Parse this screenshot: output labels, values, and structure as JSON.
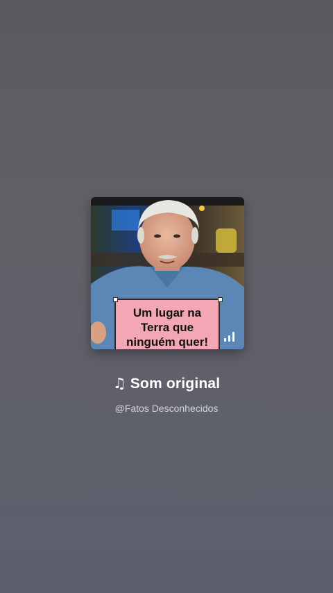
{
  "sound": {
    "cover_caption": [
      "Um lugar na",
      "Terra que",
      "ninguém quer!"
    ],
    "note_icon": "music-note-icon",
    "title": "Som original",
    "author": "@Fatos Desconhecidos"
  }
}
